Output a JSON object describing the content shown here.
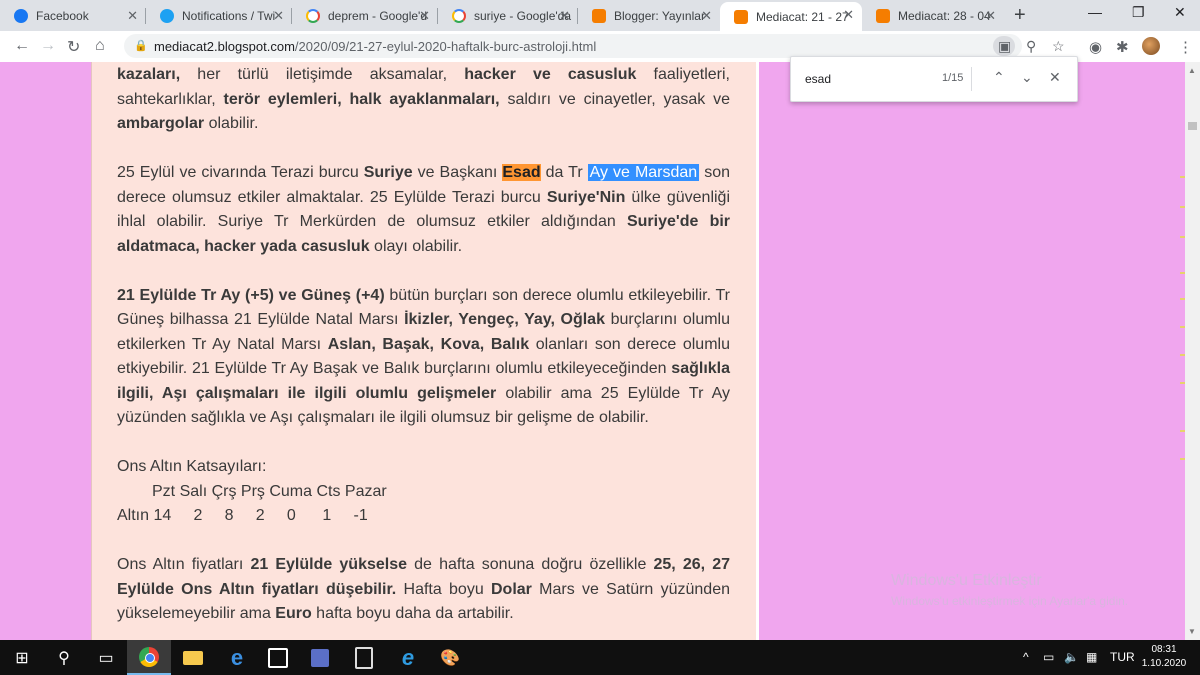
{
  "tabs": [
    {
      "title": "Facebook",
      "icon": "facebook-icon"
    },
    {
      "title": "Notifications / Twi",
      "icon": "twitter-icon"
    },
    {
      "title": "deprem - Google'd",
      "icon": "google-icon"
    },
    {
      "title": "suriye - Google'da",
      "icon": "google-icon"
    },
    {
      "title": "Blogger: Yayınlar",
      "icon": "blogger-icon"
    },
    {
      "title": "Mediacat: 21 - 27",
      "icon": "blogger-icon"
    },
    {
      "title": "Mediacat: 28 - 04",
      "icon": "blogger-icon"
    }
  ],
  "address": {
    "host": "mediacat2.blogspot.com",
    "path": "/2020/09/21-27-eylul-2020-haftalk-burc-astroloji.html"
  },
  "find": {
    "query": "esad",
    "count": "1/15"
  },
  "article": {
    "p1": {
      "a": "kazaları,",
      "b": " her türlü iletişimde aksamalar, ",
      "c": "hacker ve casusluk",
      "d": " faaliyetleri, sahtekarlıklar, ",
      "e": "terör eylemleri, halk ayaklanmaları,",
      "f": " saldırı ve cinayetler, yasak ve ",
      "g": "ambargolar",
      "h": " olabilir."
    },
    "p2": {
      "a": "25 Eylül ve civarında Terazi burcu ",
      "b": "Suriye",
      "c": " ve Başkanı ",
      "d": "Esad",
      "e": " da Tr ",
      "f": "Ay ve Marsdan",
      "g": " son derece olumsuz etkiler almaktalar. 25 Eylülde Terazi burcu ",
      "h": "Suriye'Nin",
      "i": " ülke güvenliği ihlal olabilir. Suriye Tr Merkürden de olumsuz etkiler aldığından ",
      "j": "Suriye'de bir aldatmaca, hacker yada casusluk",
      "k": " olayı olabilir."
    },
    "p3": {
      "a": "21 Eylülde Tr Ay (+5) ve Güneş (+4)",
      "b": " bütün burçları son derece olumlu etkileyebilir. Tr Güneş bilhassa 21 Eylülde Natal Marsı ",
      "c": "İkizler, Yengeç, Yay, Oğlak",
      "d": " burçlarını olumlu etkilerken Tr Ay Natal Marsı ",
      "e": "Aslan, Başak, Kova, Balık",
      "f": " olanları son derece olumlu etkiyebilir. 21 Eylülde Tr Ay Başak ve Balık burçlarını olumlu etkileyeceğinden ",
      "g": "sağlıkla ilgili, Aşı çalışmaları ile ilgili olumlu gelişmeler",
      "h": " olabilir ama 25 Eylülde Tr Ay yüzünden sağlıkla ve Aşı çalışmaları ile ilgili olumsuz bir gelişme de olabilir."
    },
    "gold_heading": "Ons Altın Katsayıları:",
    "gold_days": "Pzt Salı Çrş Prş Cuma Cts Pazar",
    "gold_row": "Altın 14     2     8     2     0      1     -1",
    "p4": {
      "a": "Ons Altın fiyatları ",
      "b": "21 Eylülde yükselse",
      "c": " de hafta sonuna doğru özellikle ",
      "d": "25, 26, 27 Eylülde Ons Altın fiyatları düşebilir.",
      "e": " Hafta boyu ",
      "f": "Dolar",
      "g": " Mars ve Satürn yüzünden yükselemeyebilir ama ",
      "h": "Euro",
      "i": " hafta boyu daha da artabilir."
    }
  },
  "watermark": {
    "title": "Windows'u Etkinleştir",
    "subtitle": "Windows'u etkinleştirmek için Ayarlar'a gidin."
  },
  "taskbar": {
    "lang": "TUR",
    "time": "08:31",
    "date": "1.10.2020"
  }
}
